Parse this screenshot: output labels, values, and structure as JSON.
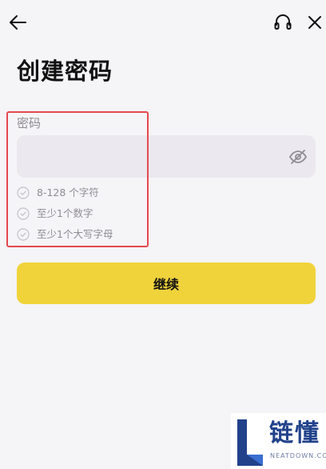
{
  "header": {
    "back_icon": "arrow-left-icon",
    "support_icon": "headset-icon",
    "close_icon": "close-icon"
  },
  "title": "创建密码",
  "form": {
    "password_label": "密码",
    "password_value": "",
    "password_placeholder": "",
    "visibility_icon": "eye-off-icon"
  },
  "requirements": [
    {
      "text": "8-128 个字符",
      "icon": "check-circle-icon",
      "met": false
    },
    {
      "text": "至少1个数字",
      "icon": "check-circle-icon",
      "met": false
    },
    {
      "text": "至少1个大写字母",
      "icon": "check-circle-icon",
      "met": false
    }
  ],
  "continue_label": "继续",
  "watermark": {
    "brand": "链懂",
    "domain": "NEATDOWN.COM",
    "logo_letter": "L"
  },
  "colors": {
    "background": "#f5f4f7",
    "input_background": "#ebe9ef",
    "primary_button": "#f0d33b",
    "highlight_outline": "#e5484f",
    "muted_text": "#8f8d93"
  }
}
